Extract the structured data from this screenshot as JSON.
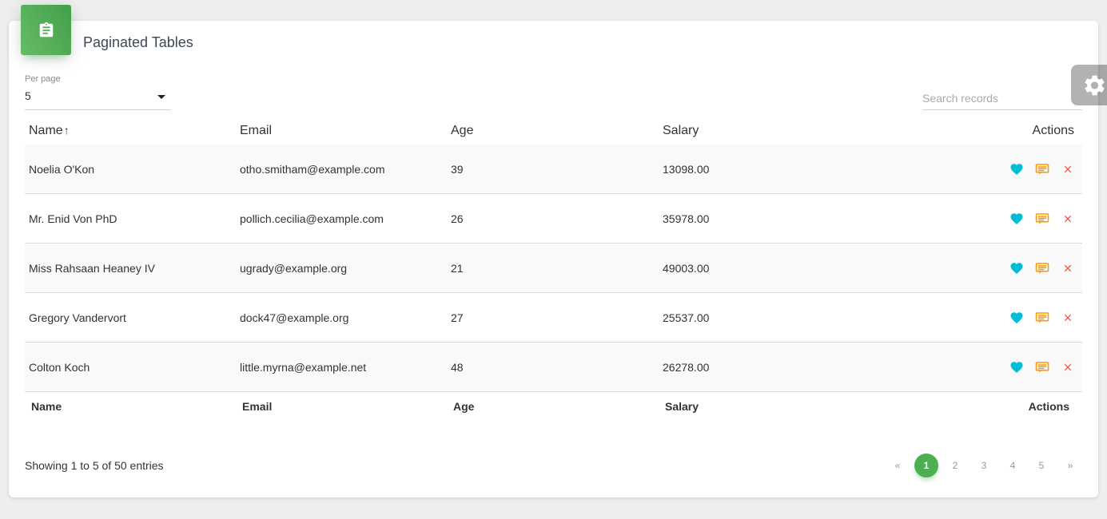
{
  "card": {
    "title": "Paginated Tables"
  },
  "per_page": {
    "label": "Per page",
    "value": "5"
  },
  "search": {
    "placeholder": "Search records"
  },
  "table": {
    "headers": {
      "name": "Name",
      "sort_arrow": "↑",
      "email": "Email",
      "age": "Age",
      "salary": "Salary",
      "actions": "Actions"
    },
    "rows": [
      {
        "name": "Noelia O'Kon",
        "email": "otho.smitham@example.com",
        "age": "39",
        "salary": "13098.00"
      },
      {
        "name": "Mr. Enid Von PhD",
        "email": "pollich.cecilia@example.com",
        "age": "26",
        "salary": "35978.00"
      },
      {
        "name": "Miss Rahsaan Heaney IV",
        "email": "ugrady@example.org",
        "age": "21",
        "salary": "49003.00"
      },
      {
        "name": "Gregory Vandervort",
        "email": "dock47@example.org",
        "age": "27",
        "salary": "25537.00"
      },
      {
        "name": "Colton Koch",
        "email": "little.myrna@example.net",
        "age": "48",
        "salary": "26278.00"
      }
    ],
    "footer": {
      "name": "Name",
      "email": "Email",
      "age": "Age",
      "salary": "Salary",
      "actions": "Actions"
    },
    "action_icons": [
      "heart-icon",
      "comment-icon",
      "close-icon"
    ]
  },
  "showing_text": "Showing 1 to 5 of 50 entries",
  "pagination": {
    "first": "«",
    "pages": [
      "1",
      "2",
      "3",
      "4",
      "5"
    ],
    "active_page": "1",
    "last": "»"
  },
  "colors": {
    "accent_green": "#4caf50",
    "like_cyan": "#00bcd4",
    "edit_orange": "#ff9800",
    "delete_red": "#f44336"
  }
}
